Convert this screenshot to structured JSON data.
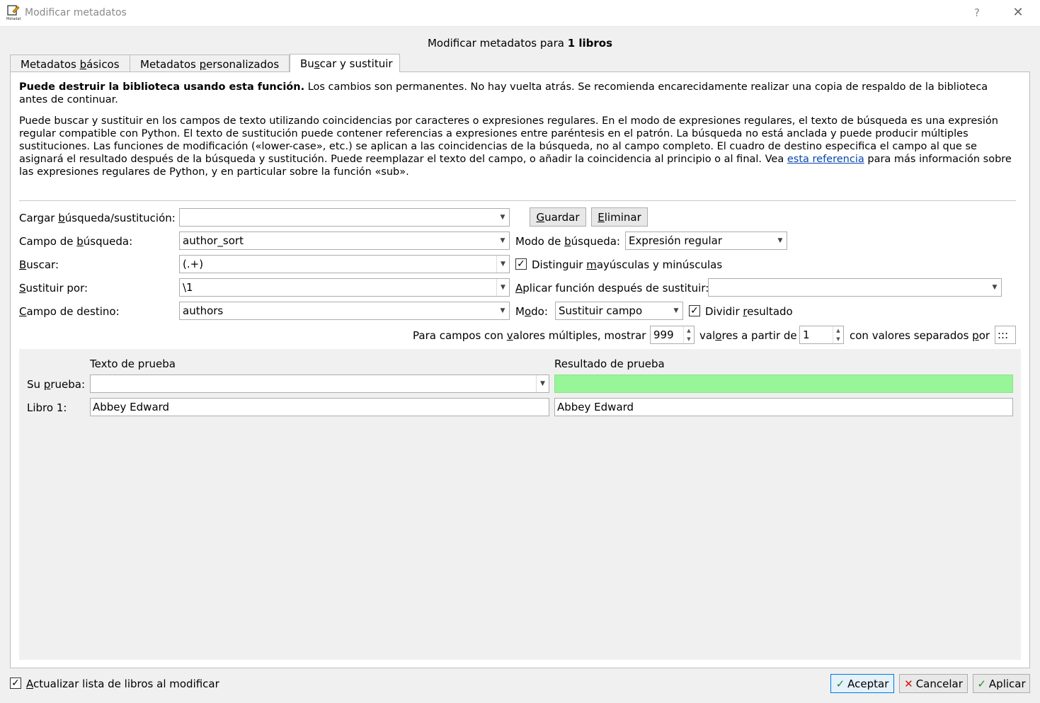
{
  "window": {
    "title": "Modificar metadatos",
    "help_glyph": "?",
    "close_glyph": "✕",
    "icon_label": "Metadat"
  },
  "header": {
    "prefix": "Modificar metadatos para",
    "count_text": "1 libros"
  },
  "tabs": [
    {
      "label_pre": "Metadatos ",
      "label_u": "b",
      "label_post": "ásicos"
    },
    {
      "label_pre": "Metadatos ",
      "label_u": "p",
      "label_post": "ersonalizados"
    },
    {
      "label_pre": "Bu",
      "label_u": "s",
      "label_post": "car y sustituir"
    }
  ],
  "warning": {
    "bold": "Puede destruir la biblioteca usando esta función.",
    "rest": " Los cambios son permanentes. No hay vuelta atrás. Se recomienda encarecidamente realizar una copia de respaldo de la biblioteca antes de continuar."
  },
  "description": {
    "text": "Puede buscar y sustituir en los campos de texto utilizando coincidencias por caracteres o expresiones regulares. En el modo de expresiones regulares, el texto de búsqueda es una expresión regular compatible con Python. El texto de sustitución puede contener referencias a expresiones entre paréntesis en el patrón. La búsqueda no está anclada y puede producir múltiples sustituciones. Las funciones de modificación («lower-case», etc.) se aplican a las coincidencias de la búsqueda, no al campo completo. El cuadro de destino especifica el campo al que se asignará el resultado después de la búsqueda y sustitución. Puede reemplazar el texto del campo, o añadir la coincidencia al principio o al final. Vea ",
    "link": "esta referencia",
    "tail": " para más información sobre las expresiones regulares de Python, y en particular sobre la función «sub»."
  },
  "form": {
    "load_label": {
      "pre": "Cargar ",
      "u": "b",
      "post": "úsqueda/sustitución:"
    },
    "load_value": "",
    "save_btn": {
      "pre": "",
      "u": "G",
      "post": "uardar"
    },
    "delete_btn": {
      "pre": "",
      "u": "E",
      "post": "liminar"
    },
    "search_field_label": {
      "pre": "Campo de ",
      "u": "b",
      "post": "úsqueda:"
    },
    "search_field_value": "author_sort",
    "search_mode_label": {
      "pre": "Modo de ",
      "u": "b",
      "post": "úsqueda:"
    },
    "search_mode_value": "Expresión regular",
    "find_label": {
      "pre": "",
      "u": "B",
      "post": "uscar:"
    },
    "find_value": "(.+)",
    "case_check": "✓",
    "case_label": {
      "pre": "Distinguir ",
      "u": "m",
      "post": "ayúsculas y minúsculas"
    },
    "replace_label": {
      "pre": "",
      "u": "S",
      "post": "ustituir por:"
    },
    "replace_value": "\\1",
    "apply_fn_label": {
      "pre": "",
      "u": "A",
      "post": "plicar función después de sustituir:"
    },
    "apply_fn_value": "",
    "dest_label": {
      "pre": "",
      "u": "C",
      "post": "ampo de destino:"
    },
    "dest_value": "authors",
    "mode_label": {
      "pre": "M",
      "u": "o",
      "post": "do:"
    },
    "mode_value": "Sustituir campo",
    "split_check": "✓",
    "split_label": {
      "pre": "Dividir ",
      "u": "r",
      "post": "esultado"
    },
    "multi_label_1": {
      "pre": "Para campos con ",
      "u": "v",
      "post": "alores múltiples, mostrar"
    },
    "multi_count": "999",
    "multi_label_2": {
      "pre": "val",
      "u": "o",
      "post": "res a partir de"
    },
    "multi_start": "1",
    "multi_label_3": {
      "pre": "con valores separados ",
      "u": "p",
      "post": "or"
    },
    "multi_sep": ":::"
  },
  "test": {
    "text_header": "Texto de prueba",
    "result_header": "Resultado de prueba",
    "your_test_label": {
      "pre": "Su ",
      "u": "p",
      "post": "rueba:"
    },
    "your_test_value": "",
    "book_label": "Libro 1:",
    "book_value": "Abbey Edward",
    "book_result": "Abbey Edward"
  },
  "footer": {
    "refresh_check": "✓",
    "refresh_label": {
      "pre": "",
      "u": "A",
      "post": "ctualizar lista de libros al modificar"
    },
    "ok_label": "Aceptar",
    "cancel_label": "Cancelar",
    "apply_label": "Aplicar",
    "ok_glyph": "✓",
    "cancel_glyph": "✕",
    "apply_glyph": "✓"
  },
  "colors": {
    "test_result_ok": "#98f598",
    "link": "#0645ad",
    "default_button_border": "#0078d7"
  }
}
